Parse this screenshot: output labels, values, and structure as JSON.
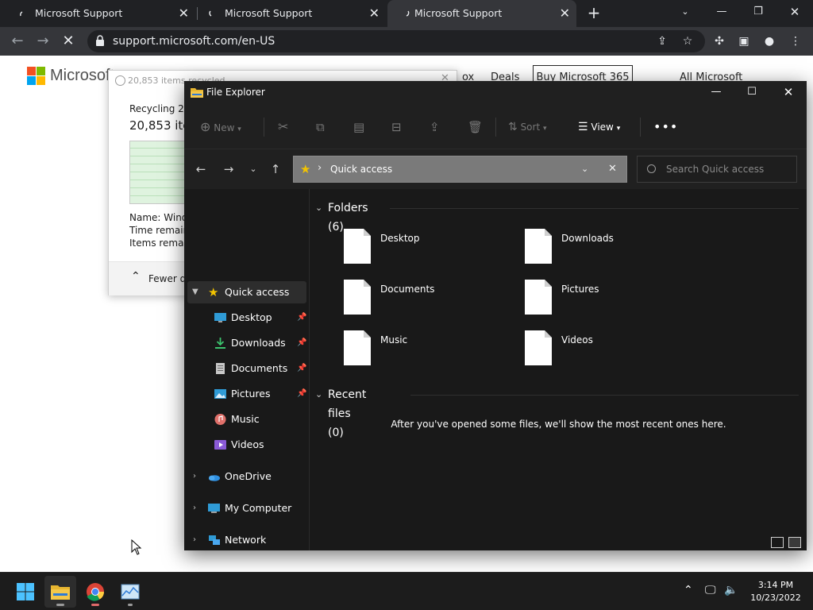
{
  "browser": {
    "tabs": [
      {
        "title": "Microsoft Support",
        "active": false
      },
      {
        "title": "Microsoft Support",
        "active": false
      },
      {
        "title": "Microsoft Support",
        "active": true
      }
    ],
    "url": "support.microsoft.com/en-US"
  },
  "webpage": {
    "brand": "Microsoft",
    "nav": [
      "ox",
      "Deals"
    ],
    "buy_button": "Buy Microsoft 365",
    "all_microsoft": "All Microsoft"
  },
  "recycle_dialog": {
    "title": "20,853 items recycled",
    "line1": "Recycling 20,",
    "line2": "20,853 ite",
    "name_label": "Name:  Windo",
    "time_label": "Time remaini",
    "items_label": "Items remain",
    "fewer_details": "Fewer de"
  },
  "explorer": {
    "title": "File Explorer",
    "commands": {
      "new": "New",
      "sort": "Sort",
      "view": "View"
    },
    "address": "Quick access",
    "search_placeholder": "Search Quick access",
    "sidebar": {
      "quick_access": "Quick access",
      "pinned": [
        "Desktop",
        "Downloads",
        "Documents",
        "Pictures"
      ],
      "unpinned": [
        "Music",
        "Videos"
      ],
      "onedrive": "OneDrive",
      "my_computer": "My Computer",
      "network": "Network"
    },
    "folders_header": "Folders (6)",
    "folders": [
      "Desktop",
      "Downloads",
      "Documents",
      "Pictures",
      "Music",
      "Videos"
    ],
    "recent_header": "Recent files (0)",
    "recent_empty": "After you've opened some files, we'll show the most recent ones here."
  },
  "taskbar": {
    "time": "3:14 PM",
    "date": "10/23/2022"
  },
  "colors": {
    "chrome_dark": "#202124",
    "explorer_bg": "#191919",
    "quick_access_star": "#f2c300",
    "ms_red": "#f25022",
    "ms_green": "#7fba00",
    "ms_blue": "#00a4ef",
    "ms_yellow": "#ffb900"
  }
}
